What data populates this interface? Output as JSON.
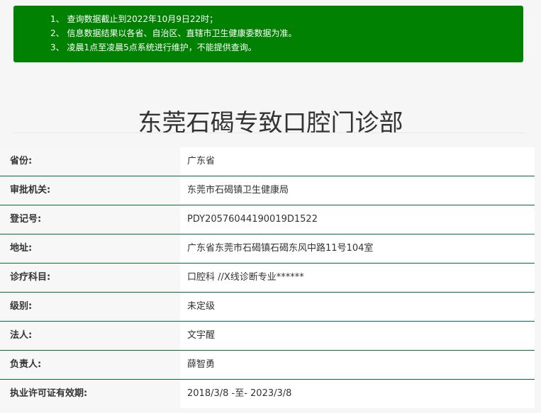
{
  "notice": {
    "lines": [
      "1、 查询数据截止到2022年10月9日22时；",
      "2、 信息数据结果以各省、自治区、直辖市卫生健康委数据为准。",
      "3、 凌晨1点至凌晨5点系统进行维护，不能提供查询。"
    ]
  },
  "title": "东莞石碣专致口腔门诊部",
  "rows": [
    {
      "label": "省份:",
      "value": "广东省"
    },
    {
      "label": "审批机关:",
      "value": "东莞市石碣镇卫生健康局"
    },
    {
      "label": "登记号:",
      "value": "PDY20576044190019D1522"
    },
    {
      "label": "地址:",
      "value": "广东省东莞市石碣镇石碣东风中路11号104室"
    },
    {
      "label": "诊疗科目:",
      "value": "口腔科 //X线诊断专业******"
    },
    {
      "label": "级别:",
      "value": "未定级"
    },
    {
      "label": "法人:",
      "value": "文宇醒"
    },
    {
      "label": "负责人:",
      "value": "薛智勇"
    },
    {
      "label": "执业许可证有效期:",
      "value": "2018/3/8 -至- 2023/3/8"
    }
  ],
  "colors": {
    "notice_background": "#018102",
    "row_divider": "#0f6b3a"
  }
}
